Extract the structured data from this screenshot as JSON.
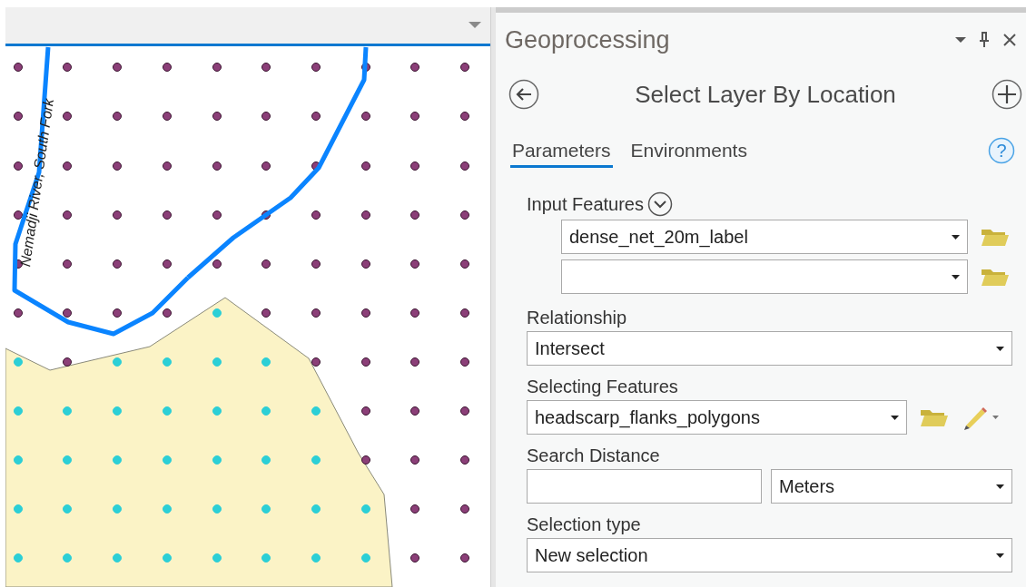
{
  "map": {
    "river_label": "Nemadji River, South Fork"
  },
  "panel": {
    "title": "Geoprocessing",
    "tool_title": "Select Layer By Location",
    "tabs": [
      {
        "label": "Parameters",
        "selected": true
      },
      {
        "label": "Environments",
        "selected": false
      }
    ],
    "help": "?",
    "parameters": [
      {
        "kind": "multi",
        "label": "Input Features",
        "values": [
          "dense_net_20m_label"
        ]
      },
      {
        "kind": "select",
        "label": "Relationship",
        "value": "Intersect"
      },
      {
        "kind": "layer",
        "label": "Selecting Features",
        "value": "headscarp_flanks_polygons"
      },
      {
        "kind": "distance",
        "label": "Search Distance",
        "unit": "Meters"
      },
      {
        "kind": "select",
        "label": "Selection type",
        "value": "New selection"
      }
    ]
  }
}
